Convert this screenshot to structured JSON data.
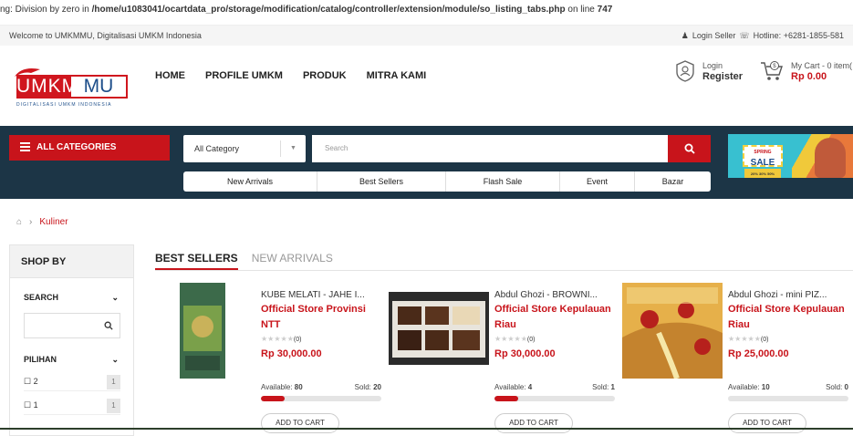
{
  "error": {
    "prefix": "ng: Division by zero in ",
    "path": "/home/u1083041/ocartdata_pro/storage/modification/catalog/controller/extension/module/so_listing_tabs.php",
    "suffix": " on line ",
    "line": "747"
  },
  "topbar": {
    "welcome": "Welcome to UMKMMU, Digitalisasi UMKM Indonesia",
    "login_seller": "Login Seller",
    "hotline": "Hotline: +6281-1855-581"
  },
  "logo": {
    "part1": "UMKM",
    "part2": "MU",
    "tagline": "DIGITALISASI UMKM INDONESIA"
  },
  "nav": [
    "HOME",
    "PROFILE UMKM",
    "PRODUK",
    "MITRA KAMI"
  ],
  "account": {
    "login": "Login",
    "register": "Register"
  },
  "cart": {
    "label": "My Cart - 0 item(",
    "total": "Rp 0.00"
  },
  "search_band": {
    "all_categories": "ALL CATEGORIES",
    "category_select": "All Category",
    "search_placeholder": "Search",
    "tabs": [
      "New Arrivals",
      "Best Sellers",
      "Flash Sale",
      "Event",
      "Bazar"
    ],
    "banner_text": "SALE",
    "banner_sub": "20% 30% 50%",
    "banner_top": "SPRING"
  },
  "breadcrumb": {
    "current": "Kuliner"
  },
  "sidebar": {
    "title": "SHOP BY",
    "search_label": "SEARCH",
    "pilihan_label": "PILIHAN",
    "options": [
      {
        "label": "2",
        "count": "1"
      },
      {
        "label": "1",
        "count": "1"
      }
    ]
  },
  "product_tabs": {
    "active": "BEST SELLERS",
    "inactive": "NEW ARRIVALS"
  },
  "products": [
    {
      "name": "KUBE MELATI - JAHE I...",
      "store": "Official Store Provinsi NTT",
      "reviews": "(0)",
      "price": "Rp 30,000.00",
      "available_label": "Available:",
      "available": "80",
      "sold_label": "Sold:",
      "sold": "20",
      "sold_fraction": 0.2,
      "button": "ADD TO CART"
    },
    {
      "name": "Abdul Ghozi - BROWNI...",
      "store": "Official Store Kepulauan Riau",
      "reviews": "(0)",
      "price": "Rp 30,000.00",
      "available_label": "Available:",
      "available": "4",
      "sold_label": "Sold:",
      "sold": "1",
      "sold_fraction": 0.2,
      "button": "ADD TO CART"
    },
    {
      "name": "Abdul Ghozi - mini PIZ...",
      "store": "Official Store Kepulauan Riau",
      "reviews": "(0)",
      "price": "Rp 25,000.00",
      "available_label": "Available:",
      "available": "10",
      "sold_label": "Sold:",
      "sold": "0",
      "sold_fraction": 0,
      "button": "ADD TO CART"
    }
  ],
  "colors": {
    "brand_red": "#c8141b",
    "band_navy": "#1c3546"
  }
}
